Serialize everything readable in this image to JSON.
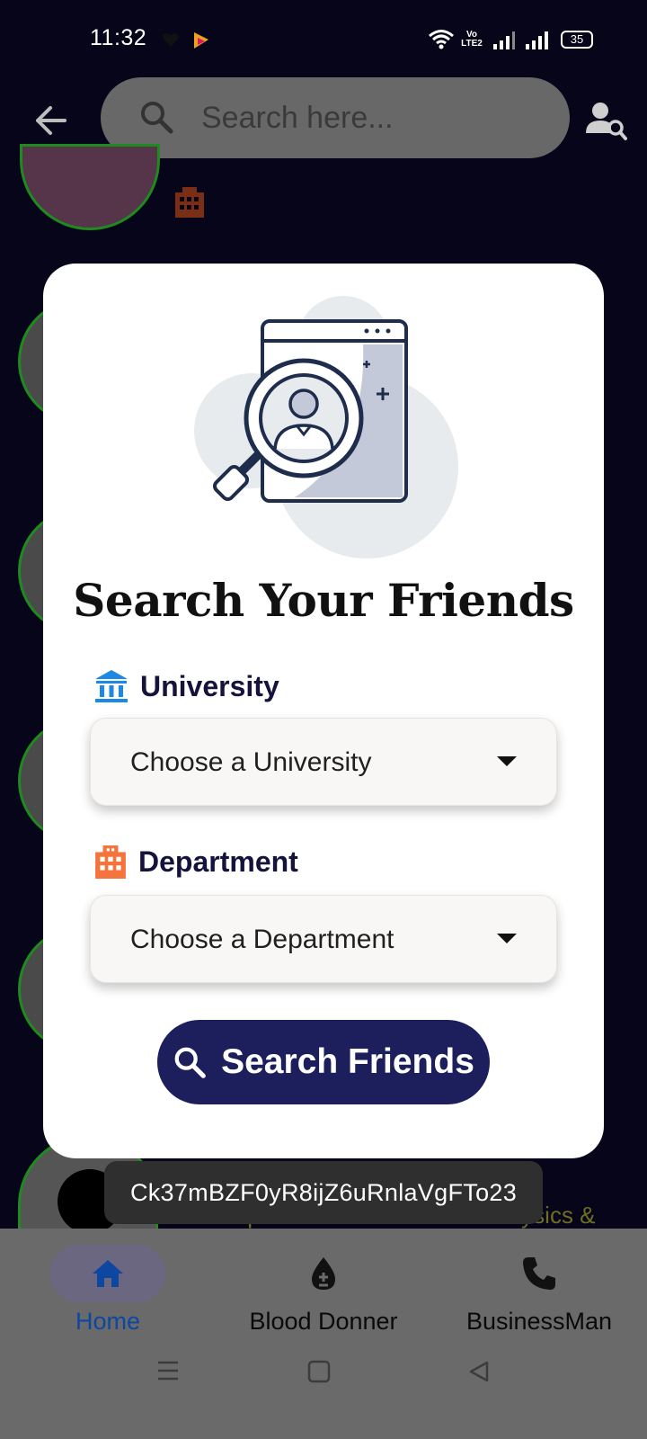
{
  "status_bar": {
    "time": "11:32",
    "battery": "35",
    "network_label": "Vo LTE2"
  },
  "header": {
    "search_placeholder": "Search here..."
  },
  "dialog": {
    "title": "Search Your Friends",
    "university_label": "University",
    "university_select_value": "Choose a University",
    "department_label": "Department",
    "department_select_value": "Choose a Department",
    "search_button_label": "Search Friends"
  },
  "background": {
    "partial_department_text": "Department of Biomedical Physics &"
  },
  "toast": {
    "text": "Ck37mBZF0yR8ijZ6uRnlaVgFTo23"
  },
  "bottom_nav": {
    "items": [
      {
        "label": "Home",
        "icon": "home-icon",
        "active": true
      },
      {
        "label": "Blood Donner",
        "icon": "blood-drop-icon",
        "active": false
      },
      {
        "label": "BusinessMan",
        "icon": "phone-icon",
        "active": false
      }
    ]
  },
  "colors": {
    "background": "#06051a",
    "dialog": "#ffffff",
    "primary_button": "#1c1f5c",
    "university_icon": "#1e88e5",
    "department_icon": "#f4743b",
    "nav_active": "#0d47a1"
  }
}
